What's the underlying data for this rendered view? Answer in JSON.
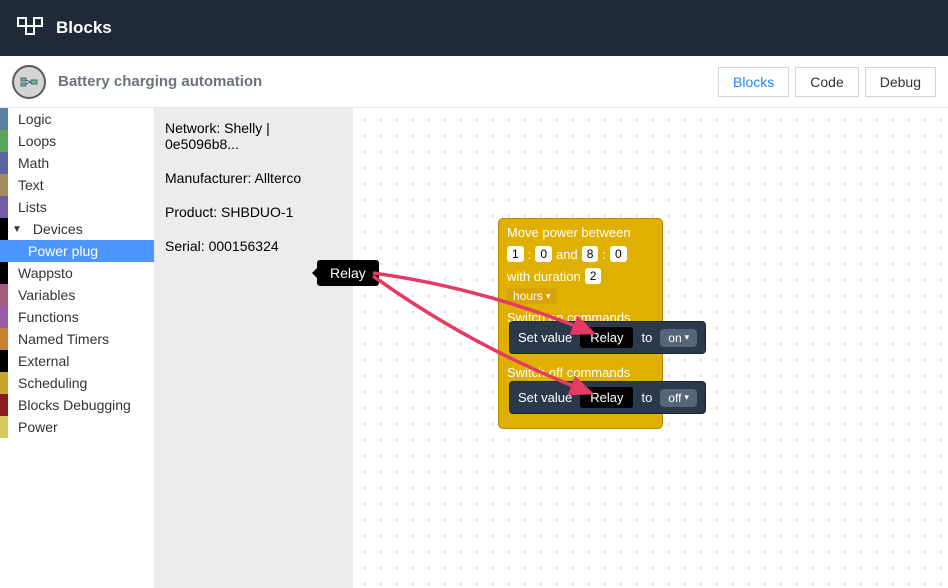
{
  "header": {
    "title": "Blocks"
  },
  "subheader": {
    "flow_title": "Battery charging automation",
    "tabs": [
      {
        "label": "Blocks",
        "active": true
      },
      {
        "label": "Code",
        "active": false
      },
      {
        "label": "Debug",
        "active": false
      }
    ]
  },
  "sidebar": {
    "items": [
      {
        "label": "Logic",
        "color": "#5b80a5"
      },
      {
        "label": "Loops",
        "color": "#5ba55b"
      },
      {
        "label": "Math",
        "color": "#5b67a5"
      },
      {
        "label": "Text",
        "color": "#a58c5b"
      },
      {
        "label": "Lists",
        "color": "#745ba5"
      },
      {
        "label": "Devices",
        "color": "#000000",
        "expandable": true
      },
      {
        "label": "Power plug",
        "color": "#4c97ff",
        "child": true,
        "selected": true
      },
      {
        "label": "Wappsto",
        "color": "#000000"
      },
      {
        "label": "Variables",
        "color": "#a55b80"
      },
      {
        "label": "Functions",
        "color": "#995ba5"
      },
      {
        "label": "Named Timers",
        "color": "#c88330"
      },
      {
        "label": "External",
        "color": "#000000"
      },
      {
        "label": "Scheduling",
        "color": "#c8a330"
      },
      {
        "label": "Blocks Debugging",
        "color": "#8b1a1a"
      },
      {
        "label": "Power",
        "color": "#d4c95b"
      }
    ]
  },
  "details": {
    "network": "Network: Shelly | 0e5096b8...",
    "manufacturer": "Manufacturer: Allterco",
    "product": "Product: SHBDUO-1",
    "serial": "Serial: 000156324"
  },
  "relay_source_label": "Relay",
  "yellow_block": {
    "title": "Move power between",
    "time1_h": "1",
    "time1_m": "0",
    "and_label": "and",
    "time2_h": "8",
    "time2_m": "0",
    "duration_label": "with duration",
    "duration_value": "2",
    "duration_unit": "hours",
    "switch_on_label": "Switch on commands",
    "switch_off_label": "Switch off commands"
  },
  "setval_on": {
    "prefix": "Set value",
    "relay": "Relay",
    "to": "to",
    "value": "on"
  },
  "setval_off": {
    "prefix": "Set value",
    "relay": "Relay",
    "to": "to",
    "value": "off"
  }
}
